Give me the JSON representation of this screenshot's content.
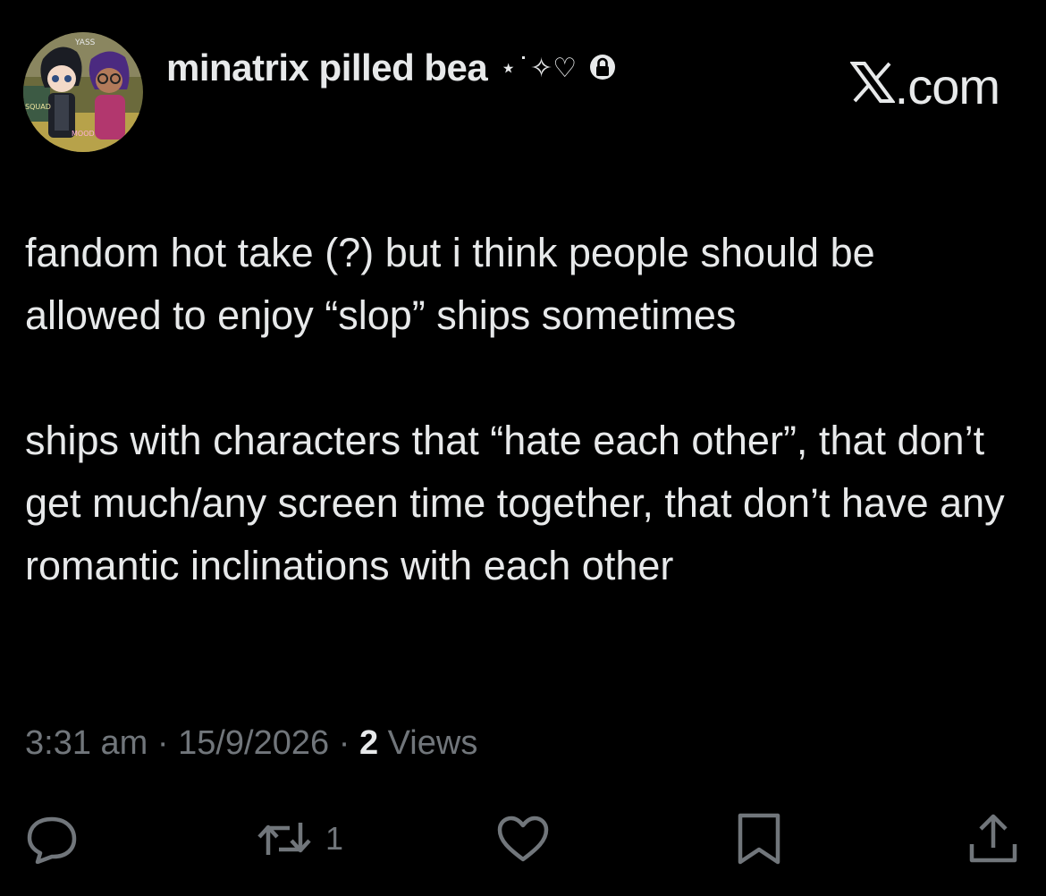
{
  "author": {
    "display_name": "minatrix pilled bea",
    "decoration": "⋆˙✧♡",
    "avatar_text": {
      "top": "YASS",
      "left": "SQUAD",
      "bottom": "MOOD"
    },
    "icon": "lock-icon"
  },
  "brand": {
    "logo_icon": "x-logo-icon",
    "domain": ".com"
  },
  "tweet": {
    "paragraphs": [
      "fandom hot take (?) but i think people should be allowed to enjoy “slop” ships sometimes",
      "ships with characters that “hate each other”, that don’t get much/any screen time together, that don’t have any romantic inclinations with each other"
    ]
  },
  "meta": {
    "time": "3:31 am",
    "separator": "·",
    "date": "15/9/2026",
    "views_count": "2",
    "views_label": "Views"
  },
  "actions": {
    "reply": {
      "icon": "reply-icon"
    },
    "repost": {
      "icon": "repost-icon",
      "count": "1"
    },
    "like": {
      "icon": "heart-icon"
    },
    "bookmark": {
      "icon": "bookmark-icon"
    },
    "share": {
      "icon": "share-icon"
    }
  },
  "colors": {
    "background": "#000000",
    "text": "#e7e9ea",
    "muted": "#71767b"
  }
}
